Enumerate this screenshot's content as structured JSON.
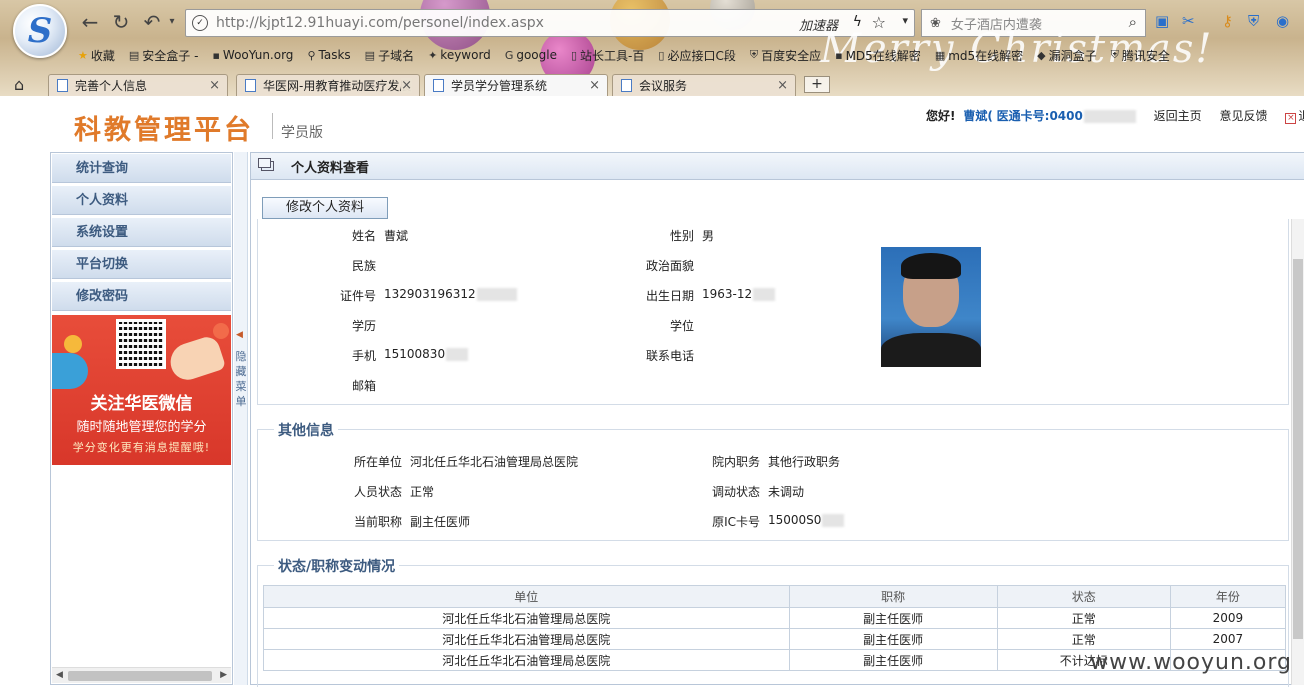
{
  "browser": {
    "logo_letter": "S",
    "url": "http://kjpt12.91huayi.com/personel/index.aspx",
    "accelerator_label": "加速器",
    "search_placeholder": "女子酒店内遭袭",
    "banner_text": "Merry Christmas!",
    "bookmarks": [
      "收藏",
      "安全盒子 -",
      "WooYun.org",
      "Tasks",
      "子域名",
      "keyword",
      "google",
      "站长工具-百",
      "必应接口C段",
      "百度安全应",
      "MD5在线解密",
      "md5在线解密",
      "漏洞盒子",
      "腾讯安全"
    ],
    "tabs": [
      {
        "label": "完善个人信息",
        "active": false
      },
      {
        "label": "华医网-用教育推动医疗发展",
        "active": false
      },
      {
        "label": "学员学分管理系统",
        "active": true
      },
      {
        "label": "会议服务",
        "active": false
      }
    ],
    "new_tab": "+"
  },
  "header": {
    "title": "科教管理平台",
    "edition": "学员版",
    "greeting": "您好!",
    "user_name": "曹斌(",
    "card_label": "医通卡号:0400",
    "links": [
      "返回主页",
      "意见反馈",
      "退出"
    ]
  },
  "sidebar": {
    "items": [
      "统计查询",
      "个人资料",
      "系统设置",
      "平台切换",
      "修改密码"
    ],
    "promo_title": "关注华医微信",
    "promo_sub1": "随时随地管理您的学分",
    "promo_sub2": "学分变化更有消息提醒哦!",
    "hide_menu": "隐藏菜单"
  },
  "main": {
    "title": "个人资料查看",
    "edit_button": "修改个人资料",
    "profile": {
      "name_label": "姓名",
      "name": "曹斌",
      "gender_label": "性别",
      "gender": "男",
      "ethnicity_label": "民族",
      "ethnicity": "",
      "politics_label": "政治面貌",
      "politics": "",
      "id_label": "证件号",
      "id": "132903196312",
      "birth_label": "出生日期",
      "birth": "1963-12",
      "education_label": "学历",
      "education": "",
      "degree_label": "学位",
      "degree": "",
      "mobile_label": "手机",
      "mobile": "15100830",
      "phone_label": "联系电话",
      "phone": "",
      "email_label": "邮箱",
      "email": ""
    },
    "other": {
      "legend": "其他信息",
      "unit_label": "所在单位",
      "unit": "河北任丘华北石油管理局总医院",
      "post_label": "院内职务",
      "post": "其他行政职务",
      "status_label": "人员状态",
      "status": "正常",
      "transfer_label": "调动状态",
      "transfer": "未调动",
      "title_label": "当前职称",
      "title": "副主任医师",
      "card_label": "原IC卡号",
      "card": "15000S0"
    },
    "history": {
      "legend": "状态/职称变动情况",
      "headers": [
        "单位",
        "职称",
        "状态",
        "年份"
      ],
      "rows": [
        [
          "河北任丘华北石油管理局总医院",
          "副主任医师",
          "正常",
          "2009"
        ],
        [
          "河北任丘华北石油管理局总医院",
          "副主任医师",
          "正常",
          "2007"
        ],
        [
          "河北任丘华北石油管理局总医院",
          "副主任医师",
          "不计达标",
          ""
        ]
      ]
    }
  },
  "watermark": "www.wooyun.org"
}
